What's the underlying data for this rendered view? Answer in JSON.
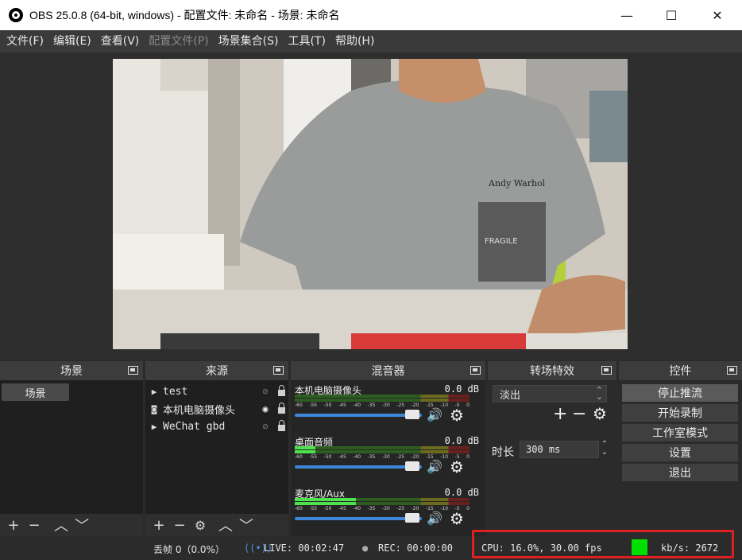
{
  "window": {
    "title": "OBS 25.0.8 (64-bit, windows) - 配置文件: 未命名 - 场景: 未命名",
    "minimize_glyph": "—",
    "maximize_glyph": "☐",
    "close_glyph": "✕"
  },
  "menu": [
    {
      "label": "文件(F)",
      "enabled": true
    },
    {
      "label": "编辑(E)",
      "enabled": true
    },
    {
      "label": "查看(V)",
      "enabled": true
    },
    {
      "label": "配置文件(P)",
      "enabled": false
    },
    {
      "label": "场景集合(S)",
      "enabled": true
    },
    {
      "label": "工具(T)",
      "enabled": true
    },
    {
      "label": "帮助(H)",
      "enabled": true
    }
  ],
  "preview": {
    "shirt_text": "Andy Warhol",
    "pocket_text": "FRAGILE"
  },
  "scenes": {
    "title": "场景",
    "items": [
      "场景"
    ]
  },
  "sources": {
    "title": "来源",
    "items": [
      {
        "name": "test",
        "icon": "play-icon",
        "visible": false
      },
      {
        "name": "本机电脑摄像头",
        "icon": "camera-icon",
        "visible": true
      },
      {
        "name": "WeChat gbd",
        "icon": "play-icon",
        "visible": false
      }
    ]
  },
  "mixer": {
    "title": "混音器",
    "scale": [
      "-60",
      "-55",
      "-50",
      "-45",
      "-40",
      "-35",
      "-30",
      "-25",
      "-20",
      "-15",
      "-10",
      "-5",
      "0"
    ],
    "channels": [
      {
        "name": "本机电脑摄像头",
        "db": "0.0 dB",
        "level": 0.0
      },
      {
        "name": "桌面音频",
        "db": "0.0 dB",
        "level": 0.12
      },
      {
        "name": "麦克风/Aux",
        "db": "0.0 dB",
        "level": 0.35
      }
    ]
  },
  "transitions": {
    "title": "转场特效",
    "selected": "淡出",
    "duration_label": "时长",
    "duration_value": "300 ms"
  },
  "controls": {
    "title": "控件",
    "buttons": [
      "停止推流",
      "开始录制",
      "工作室模式",
      "设置",
      "退出"
    ]
  },
  "status": {
    "dropped": "丢帧 0（0.0%）",
    "live": "LIVE: 00:02:47",
    "rec": "REC: 00:00:00",
    "cpu": "CPU: 16.0%, 30.00 fps",
    "kbps": "kb/s: 2672",
    "status_color": "#00e000"
  },
  "colors": {
    "highlight": "#e02020",
    "fader": "#3d86d8"
  }
}
